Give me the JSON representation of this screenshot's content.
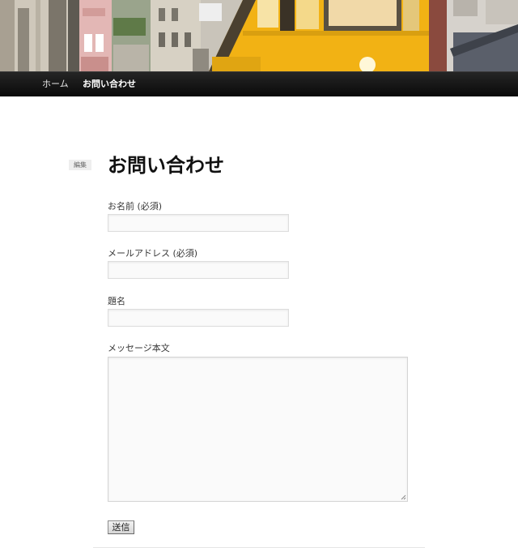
{
  "nav": {
    "items": [
      {
        "label": "ホーム",
        "current": false
      },
      {
        "label": "お問い合わせ",
        "current": true
      }
    ]
  },
  "page": {
    "edit_label": "編集",
    "title": "お問い合わせ"
  },
  "form": {
    "name_label": "お名前 (必須)",
    "email_label": "メールアドレス (必須)",
    "subject_label": "題名",
    "message_label": "メッセージ本文",
    "name_value": "",
    "email_value": "",
    "subject_value": "",
    "message_value": "",
    "submit_label": "送信"
  },
  "colors": {
    "nav_background": "#121212",
    "tram_yellow": "#f2b214",
    "input_background": "#fafafa"
  }
}
